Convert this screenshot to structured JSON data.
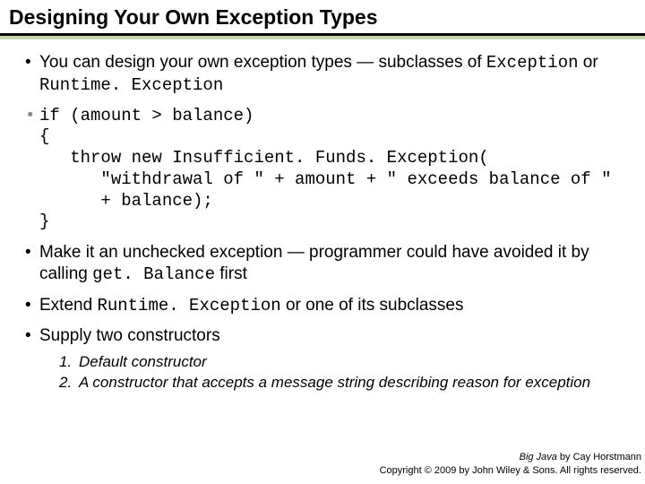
{
  "title": "Designing Your Own Exception Types",
  "bullets": {
    "b1_a": "You can design your own exception types — subclasses of ",
    "b1_code1": "Exception",
    "b1_b": " or ",
    "b1_code2": "Runtime. Exception",
    "code": "if (amount > balance)\n{\n   throw new Insufficient. Funds. Exception(\n      \"withdrawal of \" + amount + \" exceeds balance of \"\n      + balance);\n}",
    "b3_a": "Make it an unchecked exception — programmer could have avoided it by calling ",
    "b3_code": "get. Balance",
    "b3_b": " first",
    "b4_a": "Extend ",
    "b4_code": "Runtime. Exception",
    "b4_b": " or one of its subclasses",
    "b5": "Supply two constructors",
    "sub1_num": "1.",
    "sub1": "Default constructor",
    "sub2_num": "2.",
    "sub2": "A constructor that accepts a message string describing reason for exception"
  },
  "footer": {
    "book": "Big Java",
    "by": " by Cay Horstmann",
    "copyright": "Copyright © 2009 by John Wiley & Sons. All rights reserved."
  }
}
